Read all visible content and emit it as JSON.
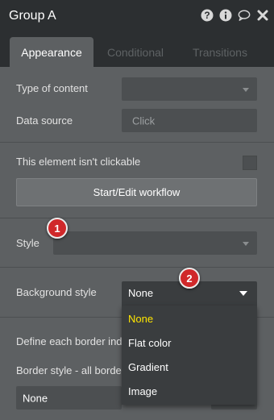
{
  "header": {
    "title": "Group A"
  },
  "icons": [
    "help-icon",
    "info-icon",
    "comment-icon",
    "close-icon"
  ],
  "tabs": [
    {
      "label": "Appearance",
      "active": true
    },
    {
      "label": "Conditional",
      "active": false
    },
    {
      "label": "Transitions",
      "active": false
    }
  ],
  "fields": {
    "type_of_content": {
      "label": "Type of content",
      "value": ""
    },
    "data_source": {
      "label": "Data source",
      "placeholder": "Click"
    },
    "not_clickable": {
      "label": "This element isn't clickable",
      "checked": false
    },
    "workflow_button": "Start/Edit workflow",
    "style": {
      "label": "Style",
      "value": ""
    },
    "background_style": {
      "label": "Background style",
      "value": "None"
    },
    "border_independently": {
      "label": "Define each border inde"
    },
    "border_style": {
      "label": "Border style - all border",
      "value": "None"
    }
  },
  "badges": [
    "1",
    "2"
  ],
  "dropdown": {
    "options": [
      "None",
      "Flat color",
      "Gradient",
      "Image"
    ],
    "selected": "None"
  },
  "colors": {
    "panel": "#5d6062",
    "header": "#2c2f31",
    "selected_option": "#ffe600",
    "badge": "#d0282a"
  }
}
